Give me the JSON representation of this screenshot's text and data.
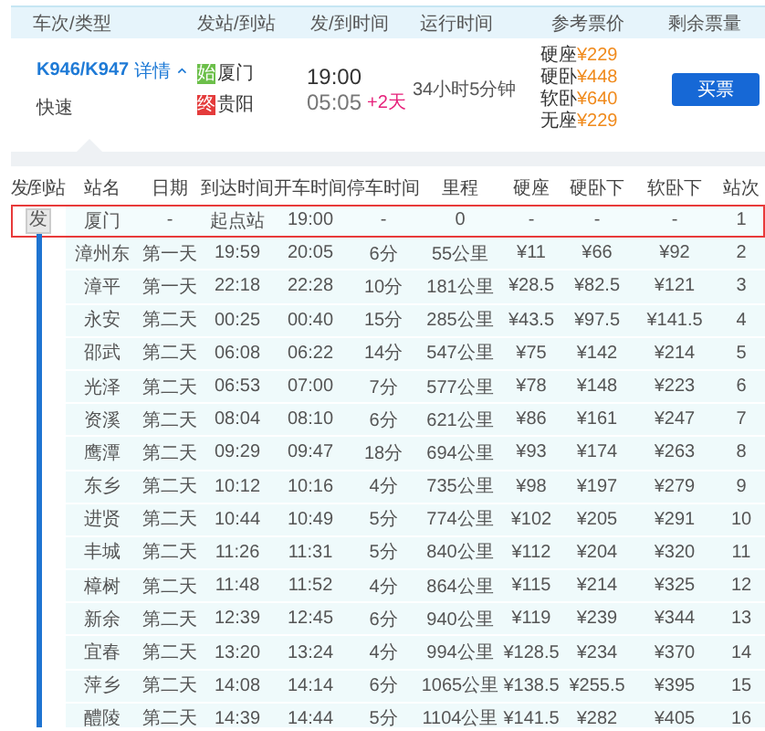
{
  "header": [
    "车次/类型",
    "发站/到站",
    "发/到时间",
    "运行时间",
    "参考票价",
    "剩余票量"
  ],
  "train": {
    "number": "K946/K947",
    "details_link": "详情",
    "expanded": true,
    "type": "快速",
    "from": {
      "badge": "始",
      "name": "厦门"
    },
    "to": {
      "badge": "终",
      "name": "贵阳"
    },
    "depart": "19:00",
    "arrive": "05:05",
    "day_offset": "+2天",
    "duration": "34小时5分钟",
    "prices": [
      {
        "seat": "硬座",
        "price": "¥229"
      },
      {
        "seat": "硬卧",
        "price": "¥448"
      },
      {
        "seat": "软卧",
        "price": "¥640"
      },
      {
        "seat": "无座",
        "price": "¥229"
      }
    ],
    "buy_button": "买票"
  },
  "stops_table": {
    "columns": [
      "发/到站",
      "站名",
      "日期",
      "到达时间",
      "开车时间",
      "停车时间",
      "里程",
      "硬座",
      "硬卧下",
      "软卧下",
      "站次"
    ],
    "rows": [
      {
        "selected": true,
        "cells": [
          "发",
          "厦门",
          "-",
          "起点站",
          "19:00",
          "-",
          "0",
          "-",
          "-",
          "-",
          "1"
        ]
      },
      {
        "selected": false,
        "cells": [
          "",
          "漳州东",
          "第一天",
          "19:59",
          "20:05",
          "6分",
          "55公里",
          "¥11",
          "¥66",
          "¥92",
          "2"
        ]
      },
      {
        "selected": false,
        "cells": [
          "",
          "漳平",
          "第一天",
          "22:18",
          "22:28",
          "10分",
          "181公里",
          "¥28.5",
          "¥82.5",
          "¥121",
          "3"
        ]
      },
      {
        "selected": false,
        "cells": [
          "",
          "永安",
          "第二天",
          "00:25",
          "00:40",
          "15分",
          "285公里",
          "¥43.5",
          "¥97.5",
          "¥141.5",
          "4"
        ]
      },
      {
        "selected": false,
        "cells": [
          "",
          "邵武",
          "第二天",
          "06:08",
          "06:22",
          "14分",
          "547公里",
          "¥75",
          "¥142",
          "¥214",
          "5"
        ]
      },
      {
        "selected": false,
        "cells": [
          "",
          "光泽",
          "第二天",
          "06:53",
          "07:00",
          "7分",
          "577公里",
          "¥78",
          "¥148",
          "¥223",
          "6"
        ]
      },
      {
        "selected": false,
        "cells": [
          "",
          "资溪",
          "第二天",
          "08:04",
          "08:10",
          "6分",
          "621公里",
          "¥86",
          "¥161",
          "¥247",
          "7"
        ]
      },
      {
        "selected": false,
        "cells": [
          "",
          "鹰潭",
          "第二天",
          "09:29",
          "09:47",
          "18分",
          "694公里",
          "¥93",
          "¥174",
          "¥263",
          "8"
        ]
      },
      {
        "selected": false,
        "cells": [
          "",
          "东乡",
          "第二天",
          "10:12",
          "10:16",
          "4分",
          "735公里",
          "¥98",
          "¥197",
          "¥279",
          "9"
        ]
      },
      {
        "selected": false,
        "cells": [
          "",
          "进贤",
          "第二天",
          "10:44",
          "10:49",
          "5分",
          "774公里",
          "¥102",
          "¥205",
          "¥291",
          "10"
        ]
      },
      {
        "selected": false,
        "cells": [
          "",
          "丰城",
          "第二天",
          "11:26",
          "11:31",
          "5分",
          "840公里",
          "¥112",
          "¥204",
          "¥320",
          "11"
        ]
      },
      {
        "selected": false,
        "cells": [
          "",
          "樟树",
          "第二天",
          "11:48",
          "11:52",
          "4分",
          "864公里",
          "¥115",
          "¥214",
          "¥325",
          "12"
        ]
      },
      {
        "selected": false,
        "cells": [
          "",
          "新余",
          "第二天",
          "12:39",
          "12:45",
          "6分",
          "940公里",
          "¥119",
          "¥239",
          "¥344",
          "13"
        ]
      },
      {
        "selected": false,
        "cells": [
          "",
          "宜春",
          "第二天",
          "13:20",
          "13:24",
          "4分",
          "994公里",
          "¥128.5",
          "¥234",
          "¥370",
          "14"
        ]
      },
      {
        "selected": false,
        "cells": [
          "",
          "萍乡",
          "第二天",
          "14:08",
          "14:14",
          "6分",
          "1065公里",
          "¥138.5",
          "¥255.5",
          "¥395",
          "15"
        ]
      },
      {
        "selected": false,
        "cells": [
          "",
          "醴陵",
          "第二天",
          "14:39",
          "14:44",
          "5分",
          "1104公里",
          "¥141.5",
          "¥282",
          "¥405",
          "16"
        ]
      }
    ]
  }
}
